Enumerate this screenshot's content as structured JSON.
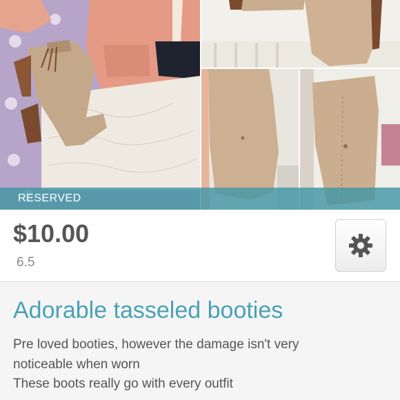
{
  "listing": {
    "status_label": "RESERVED",
    "price": "$10.00",
    "size": "6.5",
    "title": "Adorable tasseled booties",
    "description_lines": [
      "Pre loved booties, however the damage isn't very",
      "noticeable when worn",
      "These boots really go with every outfit"
    ]
  },
  "actions": {
    "settings_icon": "gear-icon"
  },
  "colors": {
    "accent": "#4aa1b4",
    "banner": "#4296a5",
    "price_text": "#555555",
    "size_text": "#8a8a8a"
  }
}
